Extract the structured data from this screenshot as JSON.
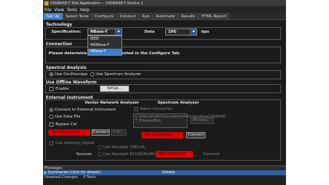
{
  "window": {
    "title": "10GBASE-T Test Application -- 10GBASE-T Device 1"
  },
  "menu": [
    "File",
    "View",
    "Tools",
    "Help"
  ],
  "tabs": [
    {
      "label": "Set Up",
      "active": true
    },
    {
      "label": "Select Tests"
    },
    {
      "label": "Configure"
    },
    {
      "label": "Connect"
    },
    {
      "label": "Run"
    },
    {
      "label": "Automate"
    },
    {
      "label": "Results"
    },
    {
      "label": "HTML Report"
    }
  ],
  "technology": {
    "heading": "Technology",
    "spec_label": "Specification:",
    "spec_value": "NBase-T",
    "spec_options": [
      "IEEE",
      "MGBase-T",
      "NBase-T"
    ],
    "data_label": "Data",
    "data_value": "10G",
    "data_unit": "bps"
  },
  "connection": {
    "heading": "Connection",
    "message": "Please determine the pair to be tested in the Configure Tab."
  },
  "spectral": {
    "heading": "Spectral Analysis",
    "opt_oscilloscope": "Use Oscilloscope",
    "opt_spectrum": "Use Spectrum Analyzer"
  },
  "offline": {
    "heading": "Use Offline Waveform",
    "enable_label": "Enable",
    "setup_button": "Setup..."
  },
  "external": {
    "heading": "External Instrument",
    "vna_title": "Vector Network Analyzer",
    "sa_title": "Spectrum Analyzer",
    "opt_connect": "Connect to External Instrument",
    "opt_datafile": "Use Data File",
    "bypass_cal": "Bypass Cal",
    "vna_status": "Not Connected",
    "vna_connect": "Connect",
    "vna_edit": "Edit...",
    "balun": "Balun Correction",
    "path_text": "C:\\Users\\Public\\Documents\\Infiniium\\Apps\\10GBASE-T_EthernetTest",
    "browse": "Browse...",
    "sa_status": "Not Connected",
    "sa_connect": "Connect",
    "use_injecting": "Use Injecting Signal",
    "opt_33612a": "Use Keysight 33612A",
    "sources_label": "Sources",
    "opt_81150": "Use Keysight 81150/60/80",
    "src_status": "Not Connected",
    "src_connect": "Connect"
  },
  "bottom": {
    "messages": "Messages",
    "summaries": "Summaries (click for details)",
    "details": "Details",
    "unsaved": "Unsaved Changes",
    "tests": "0 Tests"
  }
}
